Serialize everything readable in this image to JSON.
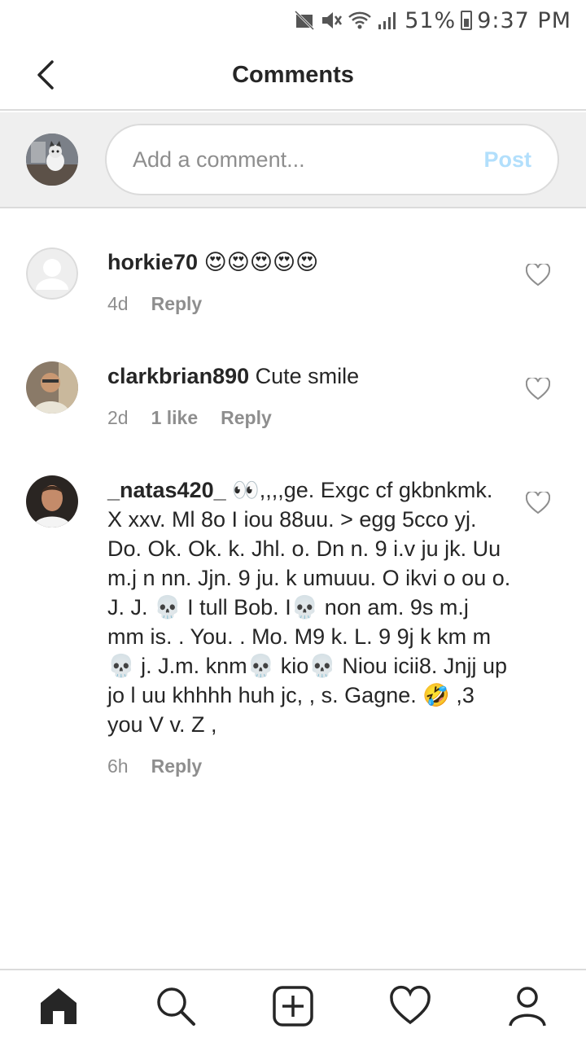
{
  "status_bar": {
    "battery": "51%",
    "time": "9:37 PM"
  },
  "app_bar": {
    "title": "Comments"
  },
  "composer": {
    "placeholder": "Add a comment...",
    "post_label": "Post"
  },
  "comments": [
    {
      "username": "horkie70",
      "text": "😍😍😍😍😍",
      "time": "4d",
      "likes": "",
      "reply_label": "Reply"
    },
    {
      "username": "clarkbrian890",
      "text": "Cute smile",
      "time": "2d",
      "likes": "1 like",
      "reply_label": "Reply"
    },
    {
      "username": "_natas420_",
      "text": "👀,,,,ge. Exgc cf gkbnkmk. X xxv. Ml 8o I iou 88uu. > egg 5cco yj. Do. Ok. Ok. k. Jhl. o. Dn n. 9 i.v ju jk. Uu m.j n nn. Jjn. 9 ju. k umuuu. O ikvi o ou o. J. J. 💀 I tull Bob. I💀 non am. 9s m.j mm is. . You. . Mo. M9 k. L. 9 9j k km m💀 j. J.m. knm💀 kio💀 Niou icii8. Jnjj up jo l uu khhhh huh jc, , s. Gagne. 🤣 ,3 you V v. Z ,",
      "time": "6h",
      "likes": "",
      "reply_label": "Reply"
    }
  ],
  "icons": {
    "back": "back-arrow-icon",
    "heart": "heart-icon",
    "nav": [
      "home-icon",
      "search-icon",
      "add-post-icon",
      "activity-heart-icon",
      "profile-icon"
    ]
  },
  "colors": {
    "post_disabled": "#b2dffc",
    "muted": "#8e8e8e",
    "divider": "#dbdbdb"
  }
}
